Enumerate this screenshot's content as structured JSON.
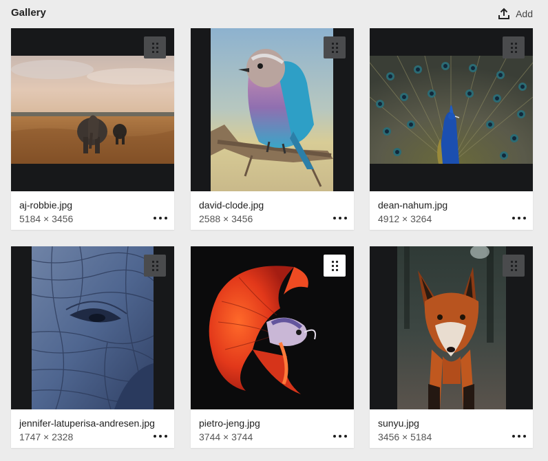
{
  "header": {
    "title": "Gallery",
    "add_label": "Add"
  },
  "items": [
    {
      "filename": "aj-robbie.jpg",
      "dimensions": "5184 × 3456",
      "subject": "elephant-savanna"
    },
    {
      "filename": "david-clode.jpg",
      "dimensions": "2588 × 3456",
      "subject": "lilac-breasted-roller"
    },
    {
      "filename": "dean-nahum.jpg",
      "dimensions": "4912 × 3264",
      "subject": "peacock"
    },
    {
      "filename": "jennifer-latuperisa-andresen.jpg",
      "dimensions": "1747 × 2328",
      "subject": "elephant-skin"
    },
    {
      "filename": "pietro-jeng.jpg",
      "dimensions": "3744 × 3744",
      "subject": "betta-fish"
    },
    {
      "filename": "sunyu.jpg",
      "dimensions": "3456 × 5184",
      "subject": "red-fox"
    }
  ],
  "icons": {
    "add": "upload-icon",
    "drag": "drag-handle-icon",
    "more": "more-options-icon"
  },
  "colors": {
    "page_background": "#ececec",
    "thumbnail_background": "#17181a",
    "handle_background": "#4a4b4d",
    "handle_active_background": "#ffffff"
  }
}
